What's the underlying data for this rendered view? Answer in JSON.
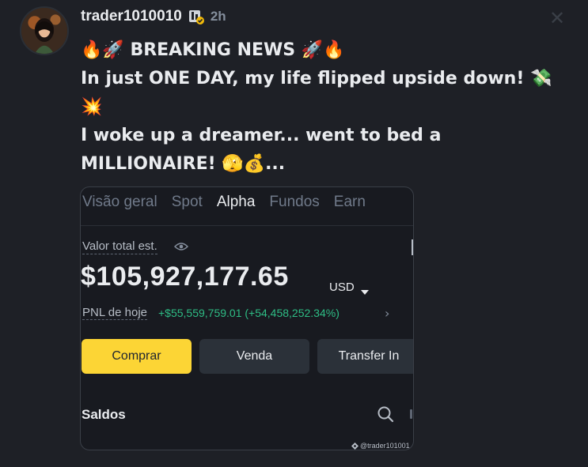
{
  "post": {
    "username": "trader1010010",
    "time": "2h",
    "lines": [
      "🔥🚀 BREAKING NEWS 🚀🔥",
      "In just ONE DAY, my life flipped upside down! 💸",
      "💥",
      "I woke up a dreamer... went to bed a",
      "MILLIONAIRE! 🫣💰..."
    ]
  },
  "screenshot": {
    "tabs": [
      "Visão geral",
      "Spot",
      "Alpha",
      "Fundos",
      "Earn"
    ],
    "active_tab": "Alpha",
    "valor_label": "Valor total est.",
    "total_value": "$105,927,177.65",
    "currency": "USD",
    "pnl_label": "PNL de hoje",
    "pnl_value": "+$55,559,759.01 (+54,458,252.34%)",
    "buttons": {
      "buy": "Comprar",
      "sell": "Venda",
      "transfer": "Transfer In"
    },
    "saldos": "Saldos",
    "watermark": "@trader101001"
  },
  "colors": {
    "background": "#1e2026",
    "accent_yellow": "#fcd535",
    "positive_green": "#2ebd85",
    "muted_text": "#848e9c"
  },
  "icons": [
    "avatar",
    "verified-badge-icon",
    "close-icon",
    "eye-icon",
    "caret-down-icon",
    "chevron-right-icon",
    "search-icon",
    "binance-logo-icon"
  ]
}
